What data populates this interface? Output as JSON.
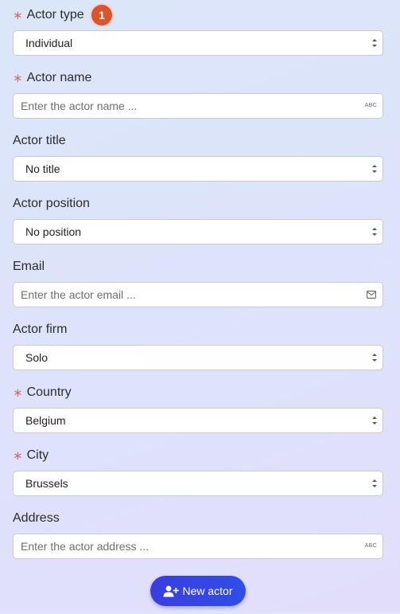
{
  "badge": {
    "text": "1"
  },
  "fields": {
    "actor_type": {
      "label": "Actor type",
      "value": "Individual",
      "required": true
    },
    "actor_name": {
      "label": "Actor name",
      "placeholder": "Enter the actor name ...",
      "required": true,
      "suffix": "ABC"
    },
    "actor_title": {
      "label": "Actor title",
      "value": "No title"
    },
    "actor_position": {
      "label": "Actor position",
      "value": "No position"
    },
    "email": {
      "label": "Email",
      "placeholder": "Enter the actor email ..."
    },
    "actor_firm": {
      "label": "Actor firm",
      "value": "Solo"
    },
    "country": {
      "label": "Country",
      "value": "Belgium",
      "required": true
    },
    "city": {
      "label": "City",
      "value": "Brussels",
      "required": true
    },
    "address": {
      "label": "Address",
      "placeholder": "Enter the actor address ...",
      "suffix": "ABC"
    }
  },
  "required_marker": "∗",
  "new_actor_button": {
    "label": "New actor",
    "icon": "user-plus-icon"
  },
  "colors": {
    "primary": "#3a3de0",
    "badge": "#d9552e",
    "required": "#c9766f"
  }
}
